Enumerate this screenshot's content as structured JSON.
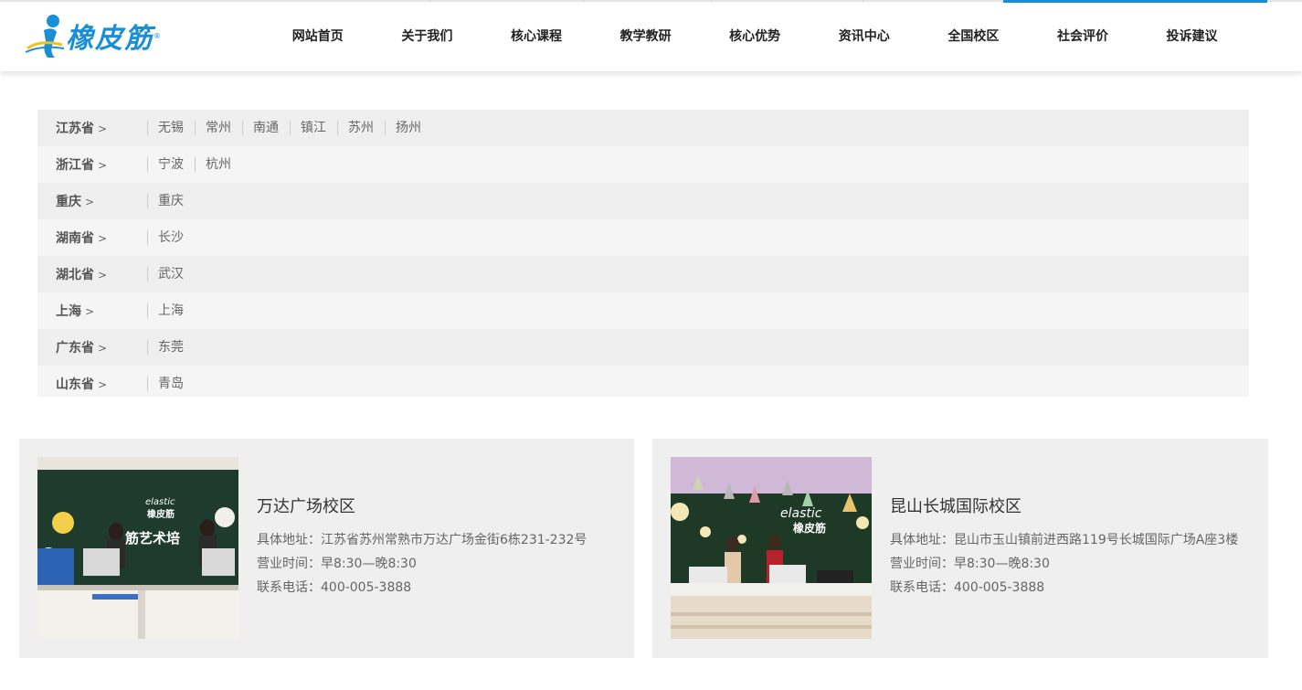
{
  "brand": {
    "logo_text": "橡皮筋",
    "logo_mark": "®",
    "accent": "#1b8fd6"
  },
  "nav": [
    {
      "label": "网站首页"
    },
    {
      "label": "关于我们"
    },
    {
      "label": "核心课程"
    },
    {
      "label": "教学教研"
    },
    {
      "label": "核心优势"
    },
    {
      "label": "资讯中心"
    },
    {
      "label": "全国校区"
    },
    {
      "label": "社会评价"
    },
    {
      "label": "投诉建议"
    }
  ],
  "regions": [
    {
      "province": "江苏省",
      "arrow": ">",
      "cities": [
        "无锡",
        "常州",
        "南通",
        "镇江",
        "苏州",
        "扬州"
      ]
    },
    {
      "province": "浙江省",
      "arrow": ">",
      "cities": [
        "宁波",
        "杭州"
      ]
    },
    {
      "province": "重庆",
      "arrow": ">",
      "cities": [
        "重庆"
      ]
    },
    {
      "province": "湖南省",
      "arrow": ">",
      "cities": [
        "长沙"
      ]
    },
    {
      "province": "湖北省",
      "arrow": ">",
      "cities": [
        "武汉"
      ]
    },
    {
      "province": "上海",
      "arrow": ">",
      "cities": [
        "上海"
      ]
    },
    {
      "province": "广东省",
      "arrow": ">",
      "cities": [
        "东莞"
      ]
    },
    {
      "province": "山东省",
      "arrow": ">",
      "cities": [
        "青岛"
      ]
    }
  ],
  "campuses": [
    {
      "name": "万达广场校区",
      "address": "具体地址：江苏省苏州常熟市万达广场金街6栋231-232号",
      "hours": "营业时间：早8:30—晚8:30",
      "phone": "联系电话：400-005-3888",
      "photo_sign": "elastic",
      "photo_sign2": "橡皮筋",
      "photo_wall": "筋艺术培"
    },
    {
      "name": "昆山长城国际校区",
      "address": "具体地址：昆山市玉山镇前进西路119号长城国际广场A座3楼",
      "hours": "营业时间：早8:30—晚8:30",
      "phone": "联系电话：400-005-3888",
      "photo_sign": "elastic",
      "photo_sign2": "橡皮筋"
    }
  ]
}
